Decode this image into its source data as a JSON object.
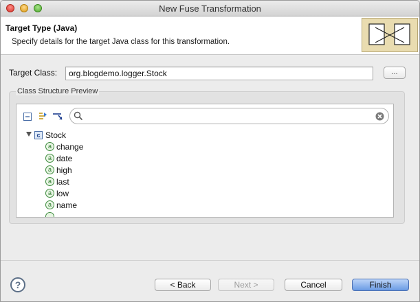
{
  "window": {
    "title": "New Fuse Transformation"
  },
  "header": {
    "title": "Target Type (Java)",
    "description": "Specify details for the target Java class for this transformation."
  },
  "form": {
    "target_class_label": "Target Class:",
    "target_class_value": "org.blogdemo.logger.Stock",
    "browse_label": "..."
  },
  "preview": {
    "group_label": "Class Structure Preview",
    "search_value": "",
    "toolbar_icons": [
      "collapse-all-icon",
      "expand-all-icon",
      "link-with-editor-icon"
    ],
    "root": {
      "label": "Stock",
      "icon": "class-icon",
      "badge": "c"
    },
    "fields": [
      {
        "label": "change",
        "badge": "a"
      },
      {
        "label": "date",
        "badge": "a"
      },
      {
        "label": "high",
        "badge": "a"
      },
      {
        "label": "last",
        "badge": "a"
      },
      {
        "label": "low",
        "badge": "a"
      },
      {
        "label": "name",
        "badge": "a"
      }
    ]
  },
  "footer": {
    "help_label": "?",
    "back_label": "< Back",
    "next_label": "Next >",
    "cancel_label": "Cancel",
    "finish_label": "Finish"
  },
  "colors": {
    "banner": "#e9dcb0",
    "primary_button": "#6a9be4",
    "field_icon": "#3f8c3f",
    "class_icon": "#4b6fa8"
  }
}
